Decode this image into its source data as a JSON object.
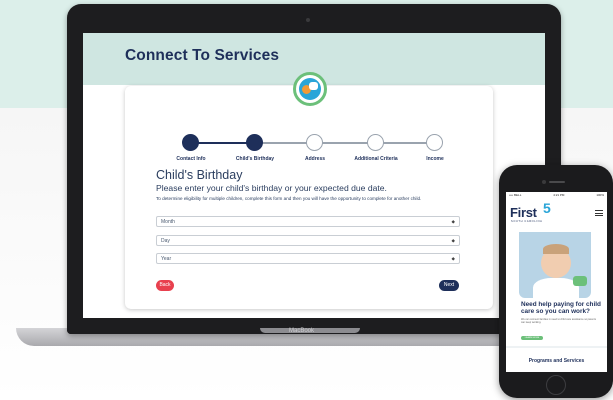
{
  "laptop": {
    "brand_label": "MacBook"
  },
  "page": {
    "title": "Connect To Services"
  },
  "stepper": {
    "steps": [
      {
        "label": "Contact Info",
        "state": "complete"
      },
      {
        "label": "Child's Birthday",
        "state": "current"
      },
      {
        "label": "Address",
        "state": "incomplete"
      },
      {
        "label": "Additional Criteria",
        "state": "incomplete"
      },
      {
        "label": "Income",
        "state": "incomplete"
      }
    ]
  },
  "form": {
    "heading": "Child's Birthday",
    "subheading": "Please enter your child's birthday or your expected due date.",
    "note": "To determine eligibility for multiple children, complete this form and then you will have the opportunity to complete for another child.",
    "month_value": "Month",
    "day_value": "Day",
    "year_value": "Year",
    "back_label": "Back",
    "next_label": "Next"
  },
  "phone": {
    "status_left": "•••• BELL",
    "status_center": "4:21 PM",
    "status_right": "100%",
    "logo_word": "First",
    "logo_number": "5",
    "logo_sub": "SOUTH CAROLINA",
    "headline": "Need help paying for child care so you can work?",
    "body": "We can connect families in need to child care assistance so parents can keep working.",
    "button_label": "LEARN MORE",
    "section_title": "Programs and Services"
  },
  "colors": {
    "navy": "#1e2f5a",
    "mint_background": "#dcefea",
    "back_button": "#e8404e",
    "accent_green": "#6cc07a",
    "accent_blue": "#2aa5d8"
  },
  "icons": {
    "badge": "speech-bubbles-icon",
    "menu": "hamburger-menu-icon",
    "select_caret": "chevron-updown-icon"
  }
}
